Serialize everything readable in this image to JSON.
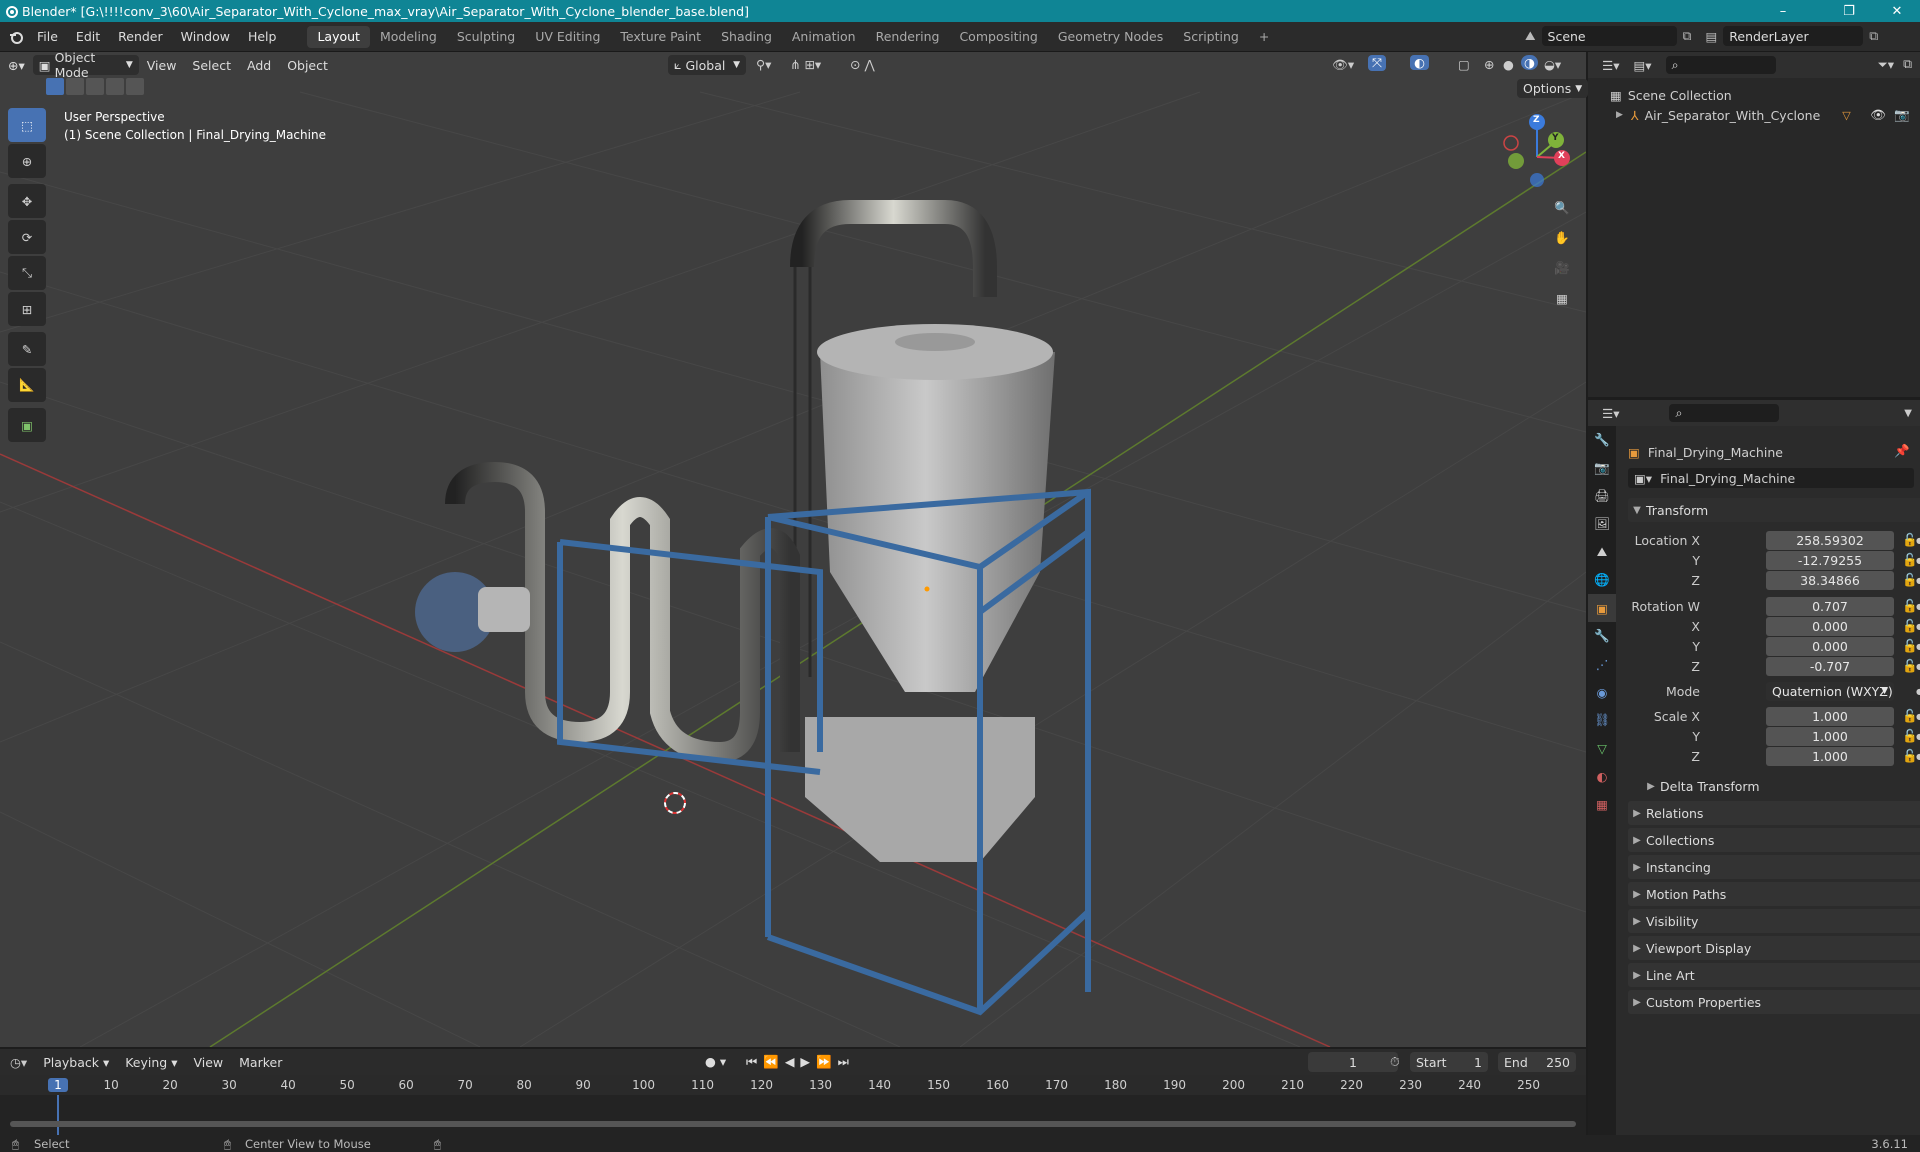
{
  "window": {
    "title": "Blender* [G:\\!!!!conv_3\\60\\Air_Separator_With_Cyclone_max_vray\\Air_Separator_With_Cyclone_blender_base.blend]",
    "minimize": "–",
    "maximize": "❐",
    "close": "✕"
  },
  "menus": [
    "File",
    "Edit",
    "Render",
    "Window",
    "Help"
  ],
  "workspaces": [
    {
      "label": "Layout",
      "active": true
    },
    {
      "label": "Modeling"
    },
    {
      "label": "Sculpting"
    },
    {
      "label": "UV Editing"
    },
    {
      "label": "Texture Paint"
    },
    {
      "label": "Shading"
    },
    {
      "label": "Animation"
    },
    {
      "label": "Rendering"
    },
    {
      "label": "Compositing"
    },
    {
      "label": "Geometry Nodes"
    },
    {
      "label": "Scripting"
    }
  ],
  "scene": {
    "name": "Scene",
    "render_layer": "RenderLayer"
  },
  "viewport": {
    "mode": "Object Mode",
    "menus": [
      "View",
      "Select",
      "Add",
      "Object"
    ],
    "orientation": "Global",
    "options": "Options",
    "overlay_line1": "User Perspective",
    "overlay_line2": "(1) Scene Collection | Final_Drying_Machine",
    "gizmo": {
      "z": "Z",
      "y": "Y",
      "x": "X"
    }
  },
  "outliner": {
    "root": "Scene Collection",
    "item": "Air_Separator_With_Cyclone"
  },
  "properties": {
    "object_name": "Final_Drying_Machine",
    "datablock": "Final_Drying_Machine",
    "transform_title": "Transform",
    "location": {
      "label": "Location X",
      "x": "258.59302",
      "y": "-12.79255",
      "z": "38.34866"
    },
    "rotation": {
      "label": "Rotation W",
      "w": "0.707",
      "x": "0.000",
      "y": "0.000",
      "z": "-0.707"
    },
    "mode_label": "Mode",
    "mode": "Quaternion (WXYZ)",
    "scale": {
      "label": "Scale X",
      "x": "1.000",
      "y": "1.000",
      "z": "1.000"
    },
    "axis": {
      "y": "Y",
      "z": "Z",
      "x": "X"
    },
    "delta": "Delta Transform",
    "panels": [
      "Relations",
      "Collections",
      "Instancing",
      "Motion Paths",
      "Visibility",
      "Viewport Display",
      "Line Art",
      "Custom Properties"
    ]
  },
  "timeline": {
    "menus": [
      "Playback",
      "Keying",
      "View",
      "Marker"
    ],
    "current_frame": "1",
    "start_label": "Start",
    "start": "1",
    "end_label": "End",
    "end": "250",
    "ticks": [
      "1",
      "10",
      "20",
      "30",
      "40",
      "50",
      "60",
      "70",
      "80",
      "90",
      "100",
      "110",
      "120",
      "130",
      "140",
      "150",
      "160",
      "170",
      "180",
      "190",
      "200",
      "210",
      "220",
      "230",
      "240",
      "250"
    ]
  },
  "status": {
    "select": "Select",
    "center": "Center View to Mouse",
    "version": "3.6.11"
  },
  "colors": {
    "titlebar": "#0f8595",
    "accent": "#4772b3",
    "frame": "#4772b3"
  }
}
